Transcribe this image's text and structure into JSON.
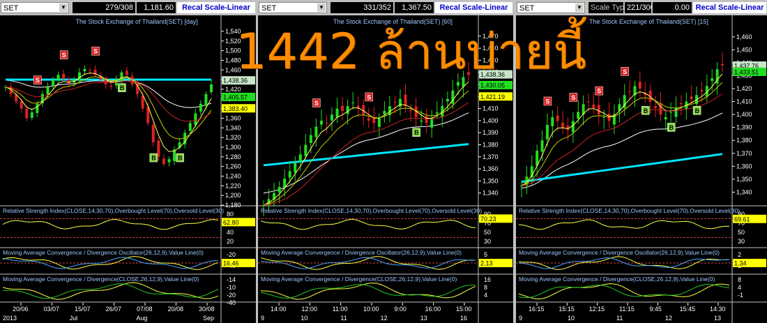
{
  "watermark": "1442 ล้านบ่ายนี้",
  "panels": [
    {
      "symbol": "SET",
      "counter": "279/308",
      "price": "1,181.60",
      "scale_button": "Recal Scale-Linear",
      "title": "The Stock Exchange of Thailand(SET) [day]",
      "rsi_title": "Relative Strength Index(CLOSE,14,30,70),Overbought Level(70),Oversold Level(30)",
      "macd_osc_title": "Moving Average Convergence / Divergence Oscillator(26,12,9),Value Line(0)",
      "macd_title": "Moving Average Convergence / Divergence(CLOSE,26,12,9),Value Line(0)",
      "price_ticks": [
        "1,540",
        "1,520",
        "1,500",
        "1,480",
        "1,460",
        "1,440",
        "1,420",
        "1,400",
        "1,380",
        "1,360",
        "1,340",
        "1,320",
        "1,300",
        "1,280",
        "1,260",
        "1,240",
        "1,220",
        "1,200",
        "1,180"
      ],
      "price_labels": [
        "1,438.36",
        "1,405.57",
        "1,383.40"
      ],
      "rsi_ticks": [
        "80",
        "60",
        "40",
        "20"
      ],
      "rsi_value": "62.80",
      "osc_ticks": [
        "-20",
        "-40"
      ],
      "osc_value": "16.46",
      "macd_ticks": [
        "-14",
        "-10",
        "-20",
        "-40"
      ],
      "x_labels": [
        "20/06",
        "03/07",
        "15/07",
        "26/07",
        "07/08",
        "20/08",
        "30/08"
      ],
      "x_labels_bottom": [
        "2013",
        "Jul",
        "Aug",
        "Sep"
      ],
      "signals": [
        "S",
        "S",
        "S",
        "B",
        "B",
        "B"
      ],
      "chart_data": {
        "type": "line",
        "y_range": [
          1180,
          1550
        ],
        "close": [
          1425,
          1410,
          1395,
          1380,
          1360,
          1372,
          1390,
          1410,
          1425,
          1440,
          1450,
          1442,
          1432,
          1440,
          1455,
          1462,
          1458,
          1450,
          1440,
          1430,
          1425,
          1440,
          1455,
          1450,
          1430,
          1410,
          1380,
          1350,
          1310,
          1280,
          1265,
          1275,
          1295,
          1310,
          1330,
          1350,
          1370,
          1390,
          1410,
          1430
        ],
        "ma_long_level": 1440
      }
    },
    {
      "symbol": "SET",
      "counter": "331/352",
      "price": "1,367.50",
      "scale_button": "Recal Scale-Linear",
      "title": "The Stock Exchange of Thailand(SET) [60]",
      "rsi_title": "Relative Strength Index(CLOSE,14,30,70),Overbought Level(70),Oversold Level(30)",
      "macd_osc_title": "Moving Average Convergence / Divergence Oscillator(26,12,9),Value Line(0)",
      "macd_title": "Moving Average Convergence / Divergence(CLOSE,26,12,9),Value Line(0)",
      "price_ticks": [
        "1,470",
        "1,460",
        "1,450",
        "1,440",
        "1,430",
        "1,420",
        "1,410",
        "1,400",
        "1,390",
        "1,380",
        "1,370",
        "1,360",
        "1,350",
        "1,340"
      ],
      "price_labels": [
        "1,438.36",
        "1,430.05",
        "1,421.19"
      ],
      "rsi_ticks": [
        "90",
        "70",
        "50",
        "30"
      ],
      "rsi_value": "70.23",
      "osc_ticks": [
        "5"
      ],
      "osc_value": "2.13",
      "macd_ticks": [
        "16",
        "8",
        "4"
      ],
      "x_labels": [
        "14:00",
        "12:00",
        "11:00",
        "10:00",
        "9:00",
        "16:00",
        "15:00"
      ],
      "x_labels_bottom": [
        "9",
        "10",
        "11",
        "12",
        "13",
        "16"
      ],
      "signals": [
        "S",
        "S",
        "B"
      ],
      "chart_data": {
        "type": "line",
        "y_range": [
          1330,
          1478
        ],
        "close": [
          1330,
          1335,
          1340,
          1345,
          1352,
          1358,
          1365,
          1372,
          1380,
          1388,
          1395,
          1400,
          1398,
          1405,
          1410,
          1408,
          1412,
          1415,
          1410,
          1405,
          1400,
          1398,
          1402,
          1408,
          1412,
          1415,
          1418,
          1412,
          1408,
          1403,
          1400,
          1398,
          1402,
          1407,
          1412,
          1418,
          1425,
          1432,
          1436,
          1438
        ],
        "ma_long_level": 1375
      }
    },
    {
      "symbol": "SET",
      "counter": "221/300",
      "price": "0.00",
      "scale_type_label": "Scale Typ",
      "scale_button": "Recal Scale-Linear",
      "title": "The Stock Exchange of Thailand(SET) [15]",
      "rsi_title": "Relative Strength Index(CLOSE,14,30,70),Overbought Level(70),Oversold Level(30)",
      "macd_osc_title": "Moving Average Convergence / Divergence Oscillator(26,12,9),Value Line(0)",
      "macd_title": "Moving Average Convergence / Divergence(CLOSE,26,12,9),Value Line(0)",
      "price_ticks": [
        "1,460",
        "1,450",
        "1,440",
        "1,430",
        "1,420",
        "1,410",
        "1,400",
        "1,390",
        "1,380",
        "1,370",
        "1,360",
        "1,350",
        "1,340"
      ],
      "price_labels": [
        "1,437.76",
        "1,433.51"
      ],
      "rsi_ticks": [
        "90",
        "70",
        "50",
        "30"
      ],
      "rsi_value": "69.61",
      "osc_ticks": [
        "2",
        "1"
      ],
      "osc_value": "1.34",
      "macd_ticks": [
        "8",
        "4",
        "-1"
      ],
      "x_labels": [
        "16:15",
        "15:15",
        "12:15",
        "11:15",
        "9:45",
        "15:45",
        "14:30"
      ],
      "x_labels_bottom": [
        "9",
        "10",
        "11",
        "12",
        "13"
      ],
      "signals": [
        "S",
        "S",
        "S",
        "S",
        "B",
        "B",
        "B"
      ],
      "chart_data": {
        "type": "line",
        "y_range": [
          1330,
          1468
        ],
        "close": [
          1345,
          1352,
          1360,
          1372,
          1380,
          1392,
          1398,
          1395,
          1390,
          1388,
          1395,
          1402,
          1408,
          1410,
          1405,
          1400,
          1398,
          1395,
          1400,
          1408,
          1415,
          1418,
          1422,
          1420,
          1415,
          1410,
          1405,
          1400,
          1398,
          1402,
          1405,
          1408,
          1410,
          1412,
          1415,
          1418,
          1422,
          1428,
          1435,
          1438
        ],
        "ma_long_level": 1360
      }
    }
  ]
}
